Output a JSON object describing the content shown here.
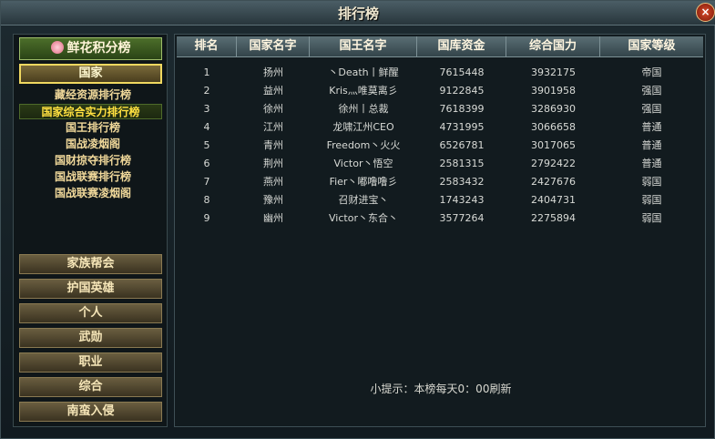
{
  "window": {
    "title": "排行榜",
    "close_label": "×"
  },
  "sidebar": {
    "flower_tab": "鲜花积分榜",
    "country_tab": "国家",
    "sub_items": [
      "藏经资源排行榜",
      "国家综合实力排行榜",
      "国王排行榜",
      "国战凌烟阁",
      "国财掠夺排行榜",
      "国战联赛排行榜",
      "国战联赛凌烟阁"
    ],
    "selected_sub_index": 1,
    "bottom_tabs": [
      "家族帮会",
      "护国英雄",
      "个人",
      "武勋",
      "职业",
      "综合",
      "南蛮入侵"
    ]
  },
  "table": {
    "headers": [
      "排名",
      "国家名字",
      "国王名字",
      "国库资金",
      "综合国力",
      "国家等级"
    ],
    "rows": [
      [
        "1",
        "扬州",
        "丶Death丨鲜醒",
        "7615448",
        "3932175",
        "帝国"
      ],
      [
        "2",
        "益州",
        "Kris灬唯莫离彡",
        "9122845",
        "3901958",
        "强国"
      ],
      [
        "3",
        "徐州",
        "徐州丨总裁",
        "7618399",
        "3286930",
        "强国"
      ],
      [
        "4",
        "江州",
        "龙啸江州CEO",
        "4731995",
        "3066658",
        "普通"
      ],
      [
        "5",
        "青州",
        "Freedom丶火火",
        "6526781",
        "3017065",
        "普通"
      ],
      [
        "6",
        "荆州",
        "Victor丶悟空",
        "2581315",
        "2792422",
        "普通"
      ],
      [
        "7",
        "燕州",
        "Fier丶嘟噜噜彡",
        "2583432",
        "2427676",
        "弱国"
      ],
      [
        "8",
        "豫州",
        "召财进宝丶",
        "1743243",
        "2404731",
        "弱国"
      ],
      [
        "9",
        "幽州",
        "Victor丶东合丶",
        "3577264",
        "2275894",
        "弱国"
      ]
    ]
  },
  "tip": "小提示：本榜每天0：00刷新",
  "colors": {
    "accent": "#f0d860",
    "selected_text": "#ffe040",
    "header_bg": "#4a5c62"
  }
}
